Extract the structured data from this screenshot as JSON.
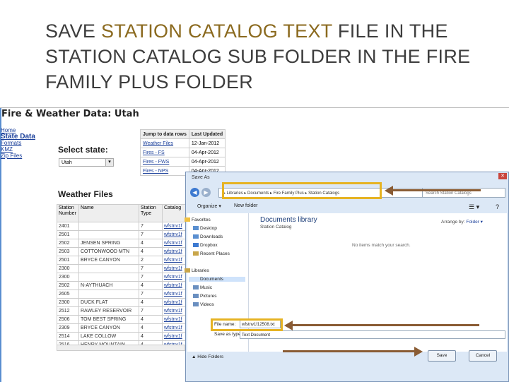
{
  "slide": {
    "title_pre": "SAVE ",
    "title_highlight": "STATION CATALOG TEXT",
    "title_post": " FILE IN THE STATION CATALOG SUB FOLDER IN THE FIRE FAMILY PLUS FOLDER",
    "highlight_color": "#8b6a1f"
  },
  "page": {
    "heading": "Fire & Weather Data: Utah",
    "left_links": [
      "Home",
      "State Data",
      "Formats",
      "KMZ",
      "Zip Files"
    ],
    "select_label": "Select state:",
    "select_value": "Utah",
    "jump_headers": [
      "Jump to data rows",
      "Last Updated"
    ],
    "jump_rows": [
      [
        "Weather Files",
        "12-Jan-2012"
      ],
      [
        "Fires - FS",
        "04-Apr-2012"
      ],
      [
        "Fires - FWS",
        "04-Apr-2012"
      ],
      [
        "Fires - NPS",
        "04-Apr-2012"
      ]
    ],
    "weather_title": "Weather Files",
    "weather_headers": [
      "Station Number",
      "Name",
      "Station Type",
      "Catalog"
    ],
    "weather_rows": [
      [
        "2401",
        "",
        "7",
        "wfstnv1f"
      ],
      [
        "2501",
        "",
        "7",
        "wfstnv1f"
      ],
      [
        "2502",
        "JENSEN SPRING",
        "4",
        "wfstnv1f"
      ],
      [
        "2503",
        "COTTONWOOD MTN",
        "4",
        "wfstnv1f"
      ],
      [
        "2501",
        "BRYCE CANYON",
        "2",
        "wfstnv1f"
      ],
      [
        "2300",
        "",
        "7",
        "wfstnv1f"
      ],
      [
        "2300",
        "",
        "7",
        "wfstnv1f"
      ],
      [
        "2502",
        "N-AYTHUACH",
        "4",
        "wfstnv1f"
      ],
      [
        "2605",
        "",
        "7",
        "wfstnv1f"
      ],
      [
        "2300",
        "DUCK FLAT",
        "4",
        "wfstnv1f"
      ],
      [
        "2512",
        "RAWLEY RESERVOIR",
        "7",
        "wfstnv1f"
      ],
      [
        "2506",
        "TOM BEST SPRING",
        "4",
        "wfstnv1f"
      ],
      [
        "2309",
        "BRYCE CANYON",
        "4",
        "wfstnv1f"
      ],
      [
        "2514",
        "LAKE COLLOW",
        "4",
        "wfstnv1f"
      ],
      [
        "2516",
        "HENRY MOUNTAIN",
        "4",
        "wfstnv1f"
      ]
    ]
  },
  "dialog": {
    "title": "Save As",
    "back_glyph": "◀",
    "forward_glyph": "▶",
    "close_glyph": "✕",
    "address_path": "▸ Libraries ▸ Documents ▸ Fire Family Plus ▸ Station Catalogs",
    "search_placeholder": "Search Station Catalogs",
    "organize": "Organize ▾",
    "new_folder": "New folder",
    "view_glyph": "☰ ▾",
    "help_glyph": "?",
    "nav_items": [
      "Favorites",
      "Desktop",
      "Downloads",
      "Dropbox",
      "Recent Places",
      "Libraries",
      "Documents",
      "Music",
      "Pictures",
      "Videos"
    ],
    "library_title": "Documents library",
    "library_sub": "Station Catalog",
    "arrange_label": "Arrange by:",
    "arrange_value": "Folder ▾",
    "empty_message": "No items match your search.",
    "filename_label": "File name:",
    "filename_value": "wfstnv1f12508.txt",
    "savetype_label": "Save as type:",
    "savetype_value": "Text Document",
    "hide_folders": "▲ Hide Folders",
    "save_label": "Save",
    "cancel_label": "Cancel"
  },
  "annotation_colors": {
    "box": "#e6b323",
    "arrow": "#8a5c34"
  }
}
